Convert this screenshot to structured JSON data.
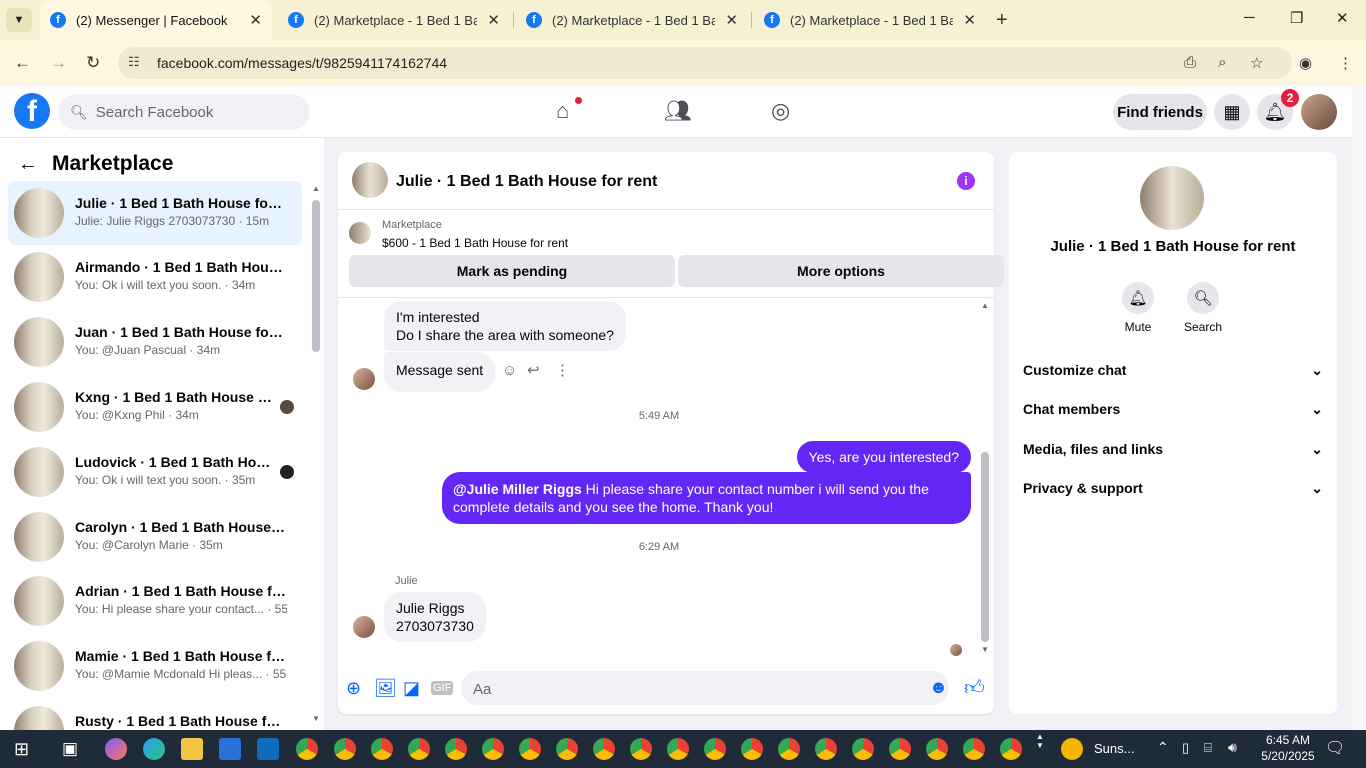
{
  "browser": {
    "tabs": [
      {
        "title": "(2) Messenger | Facebook",
        "active": true
      },
      {
        "title": "(2) Marketplace - 1 Bed 1 Bath",
        "active": false
      },
      {
        "title": "(2) Marketplace - 1 Bed 1 Bath",
        "active": false
      },
      {
        "title": "(2) Marketplace - 1 Bed 1 Bath",
        "active": false
      }
    ],
    "url": "facebook.com/messages/t/9825941174162744"
  },
  "fb": {
    "search_placeholder": "Search Facebook",
    "find_friends": "Find friends",
    "notif_count": "2"
  },
  "sidebar": {
    "title": "Marketplace",
    "conversations": [
      {
        "name": "Julie · 1 Bed 1 Bath House for rent",
        "preview": "Julie: Julie Riggs 2703073730 · 15m"
      },
      {
        "name": "Airmando · 1 Bed 1 Bath House f...",
        "preview": "You: Ok i will text you soon. · 34m"
      },
      {
        "name": "Juan · 1 Bed 1 Bath House for rent",
        "preview": "You: @Juan Pascual · 34m"
      },
      {
        "name": "Kxng · 1 Bed 1 Bath House for ...",
        "preview": "You: @Kxng Phil · 34m"
      },
      {
        "name": "Ludovick · 1 Bed 1 Bath House...",
        "preview": "You: Ok i will text you soon. · 35m"
      },
      {
        "name": "Carolyn · 1 Bed 1 Bath House for...",
        "preview": "You: @Carolyn Marie · 35m"
      },
      {
        "name": "Adrian · 1 Bed 1 Bath House for r...",
        "preview": "You: Hi please share your contact... · 55m"
      },
      {
        "name": "Mamie · 1 Bed 1 Bath House for ...",
        "preview": "You: @Mamie Mcdonald Hi pleas... · 55m"
      },
      {
        "name": "Rusty · 1 Bed 1 Bath House for...",
        "preview": ""
      }
    ]
  },
  "chat": {
    "title": "Julie · 1 Bed 1 Bath House for rent",
    "marketplace_label": "Marketplace",
    "listing": "$600 - 1 Bed 1 Bath House for rent",
    "mark_pending": "Mark as pending",
    "more_options": "More options",
    "msg1_line1": "I'm interested",
    "msg1_line2": "Do I share the area with someone?",
    "msg2": "Message sent",
    "time1": "5:49 AM",
    "out1": "Yes, are you interested?",
    "out2_mention": "@Julie Miller Riggs",
    "out2_text": " Hi please share your contact number i will send you the",
    "out2_line2": "complete details and you see the home. Thank you!",
    "time2": "6:29 AM",
    "sender": "Julie",
    "in3_line1": "Julie Riggs",
    "in3_line2": "2703073730",
    "compose_placeholder": "Aa"
  },
  "details": {
    "name": "Julie · 1 Bed 1 Bath House for rent",
    "mute": "Mute",
    "search": "Search",
    "sections": [
      "Customize chat",
      "Chat members",
      "Media, files and links",
      "Privacy & support"
    ]
  },
  "taskbar": {
    "weather": "Suns...",
    "time": "6:45 AM",
    "date": "5/20/2025"
  }
}
